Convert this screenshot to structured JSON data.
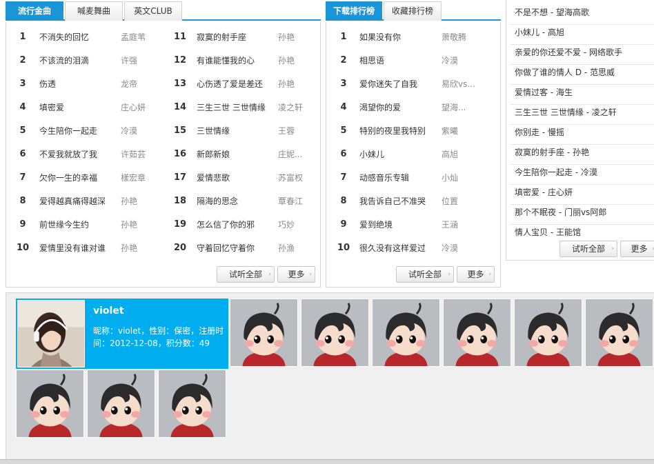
{
  "panel1": {
    "tabs": [
      "流行金曲",
      "喊麦舞曲",
      "英文CLUB"
    ],
    "rows": [
      {
        "num": "1",
        "song": "不消失的回忆",
        "artist": "孟庭苇"
      },
      {
        "num": "2",
        "song": "不该流的泪滴",
        "artist": "许强"
      },
      {
        "num": "3",
        "song": "伤透",
        "artist": "龙帝"
      },
      {
        "num": "4",
        "song": "填密爱",
        "artist": "庄心妍"
      },
      {
        "num": "5",
        "song": "今生陪你一起走",
        "artist": "冷漠"
      },
      {
        "num": "6",
        "song": "不爱我就放了我",
        "artist": "许茹芸"
      },
      {
        "num": "7",
        "song": "欠你一生的幸福",
        "artist": "樣宏章"
      },
      {
        "num": "8",
        "song": "爱得越真痛得越深",
        "artist": "孙艳"
      },
      {
        "num": "9",
        "song": "前世缘今生约",
        "artist": "孙艳"
      },
      {
        "num": "10",
        "song": "爱情里没有谁对谁",
        "artist": "孙艳"
      },
      {
        "num": "11",
        "song": "寂寞的射手座",
        "artist": "孙艳"
      },
      {
        "num": "12",
        "song": "有谁能懂我的心",
        "artist": "孙艳"
      },
      {
        "num": "13",
        "song": "心伤透了爱是差还",
        "artist": "孙艳"
      },
      {
        "num": "14",
        "song": "三生三世 三世情缘",
        "artist": "凌之轩"
      },
      {
        "num": "15",
        "song": "三世情缘",
        "artist": "王蓉"
      },
      {
        "num": "16",
        "song": "新郎新娘",
        "artist": "庄妮..."
      },
      {
        "num": "17",
        "song": "爱情悲歌",
        "artist": "苏富权"
      },
      {
        "num": "18",
        "song": "隔海的思念",
        "artist": "覃春江"
      },
      {
        "num": "19",
        "song": "怎么信了你的邪",
        "artist": "巧妙"
      },
      {
        "num": "20",
        "song": "守着回忆守着你",
        "artist": "孙渔"
      }
    ],
    "btn_all": "试听全部",
    "btn_more": "更多"
  },
  "panel2": {
    "tabs": [
      "下载排行榜",
      "收藏排行榜"
    ],
    "rows": [
      {
        "num": "1",
        "song": "如果没有你",
        "artist": "萧敬腾"
      },
      {
        "num": "2",
        "song": "相思语",
        "artist": "冷漠"
      },
      {
        "num": "3",
        "song": "爱你迷失了自我",
        "artist": "易欣vs..."
      },
      {
        "num": "4",
        "song": "渴望你的爱",
        "artist": "望海..."
      },
      {
        "num": "5",
        "song": "特别的夜里我特别",
        "artist": "紫曦"
      },
      {
        "num": "6",
        "song": "小妹儿",
        "artist": "高旭"
      },
      {
        "num": "7",
        "song": "动感音乐专辑",
        "artist": "小灿"
      },
      {
        "num": "8",
        "song": "我告诉自己不准哭",
        "artist": "位置"
      },
      {
        "num": "9",
        "song": "爱到绝境",
        "artist": "王涵"
      },
      {
        "num": "10",
        "song": "很久没有这样爱过",
        "artist": "冷漠"
      }
    ],
    "btn_all": "试听全部",
    "btn_more": "更多"
  },
  "panel3": {
    "items": [
      "不是不想 - 望海高歌",
      "小妹儿 - 高旭",
      "亲爱的你还爱不爱 - 网络歌手",
      "你做了谁的情人 D - 范思威",
      "爱情过客 - 海生",
      "三生三世 三世情缘 - 凌之轩",
      "你别走 - 慢摇",
      "寂寞的射手座 - 孙艳",
      "今生陪你一起走 - 冷漠",
      "填密爱 - 庄心妍",
      "那个不眠夜 - 门丽vs阿郎",
      "情人宝贝 - 王能馆"
    ],
    "btn_all": "试听全部",
    "btn_more": "更多"
  },
  "member": {
    "name": "violet",
    "info": "昵称：violet，性别：保密，注册时间：2012-12-08，积分数：49"
  },
  "colors": {
    "accent": "#1a95d8",
    "featured_bg": "#00aeef"
  },
  "avatar_icon": "cartoon-boy-avatar-icon"
}
